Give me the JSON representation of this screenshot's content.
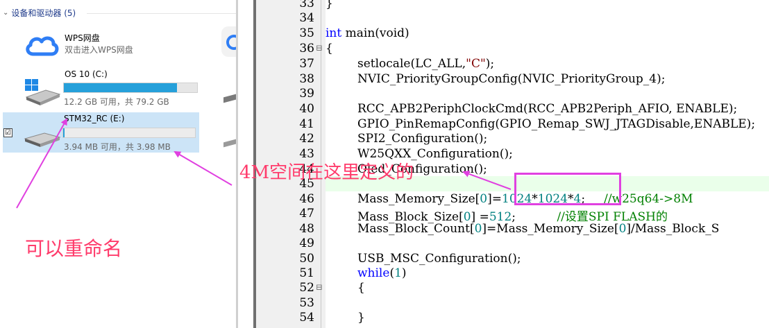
{
  "explorer": {
    "group_header": "设备和驱动器 (5)",
    "drives": [
      {
        "name": "WPS网盘",
        "subtitle": "双击进入WPS网盘"
      },
      {
        "name": "OS 10 (C:)",
        "usage": "12.2 GB 可用，共 79.2 GB",
        "used_fraction": 0.85
      },
      {
        "name": "STM32_RC (E:)",
        "usage": "3.94 MB 可用，共 3.98 MB",
        "used_fraction": 0.01
      }
    ]
  },
  "editor": {
    "lines": [
      {
        "n": "33"
      },
      {
        "n": "34"
      },
      {
        "n": "35"
      },
      {
        "n": "36"
      },
      {
        "n": "37"
      },
      {
        "n": "38"
      },
      {
        "n": "39"
      },
      {
        "n": "40"
      },
      {
        "n": "41"
      },
      {
        "n": "42"
      },
      {
        "n": "43"
      },
      {
        "n": "44"
      },
      {
        "n": "45"
      },
      {
        "n": "46"
      },
      {
        "n": "47"
      },
      {
        "n": "48"
      },
      {
        "n": "49"
      },
      {
        "n": "50"
      },
      {
        "n": "51"
      },
      {
        "n": "52"
      },
      {
        "n": "53"
      },
      {
        "n": "54"
      }
    ]
  },
  "annotations": {
    "space_defined_here": "4M空间在这里定义的",
    "can_rename": "可以重命名"
  },
  "colors": {
    "annotation": "#ff3b6b",
    "box": "#e040e0",
    "drive_fill": "#26a0da"
  }
}
